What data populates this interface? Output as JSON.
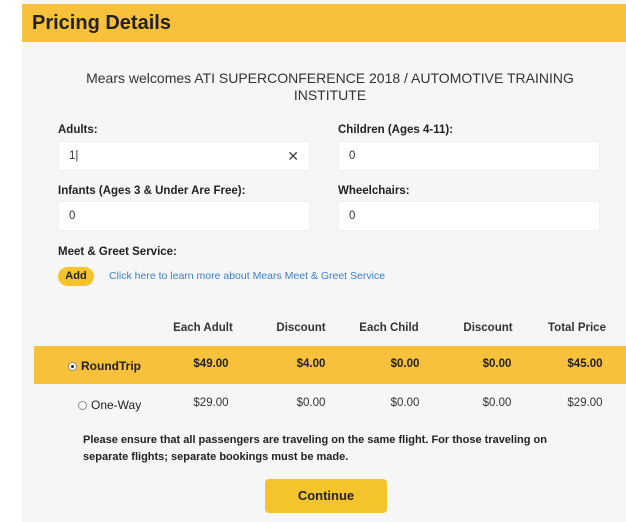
{
  "header": {
    "title": "Pricing Details"
  },
  "welcome_text": "Mears welcomes ATI SUPERCONFERENCE 2018 / AUTOMOTIVE TRAINING INSTITUTE",
  "fields": {
    "adults": {
      "label": "Adults:",
      "value": "1|",
      "clear_glyph": "✕"
    },
    "children": {
      "label": "Children (Ages 4-11):",
      "value": "0"
    },
    "infants": {
      "label": "Infants (Ages 3 & Under Are Free):",
      "value": "0"
    },
    "wheelchairs": {
      "label": "Wheelchairs:",
      "value": "0"
    }
  },
  "meet_greet": {
    "label": "Meet & Greet Service:",
    "add_label": "Add",
    "link_text": "Click here to learn more about Mears Meet & Greet Service"
  },
  "pricing_table": {
    "headers": [
      "Each Adult",
      "Discount",
      "Each Child",
      "Discount",
      "Total Price"
    ],
    "rows": [
      {
        "label": "RoundTrip",
        "selected": true,
        "values": [
          "$49.00",
          "$4.00",
          "$0.00",
          "$0.00",
          "$45.00"
        ]
      },
      {
        "label": "One-Way",
        "selected": false,
        "values": [
          "$29.00",
          "$0.00",
          "$0.00",
          "$0.00",
          "$29.00"
        ]
      }
    ]
  },
  "notice": "Please ensure that all passengers are traveling on the same flight. For those traveling on separate flights; separate bookings must be made.",
  "continue_label": "Continue",
  "colors": {
    "accent": "#f8c13b",
    "link": "#3b7fd1"
  }
}
